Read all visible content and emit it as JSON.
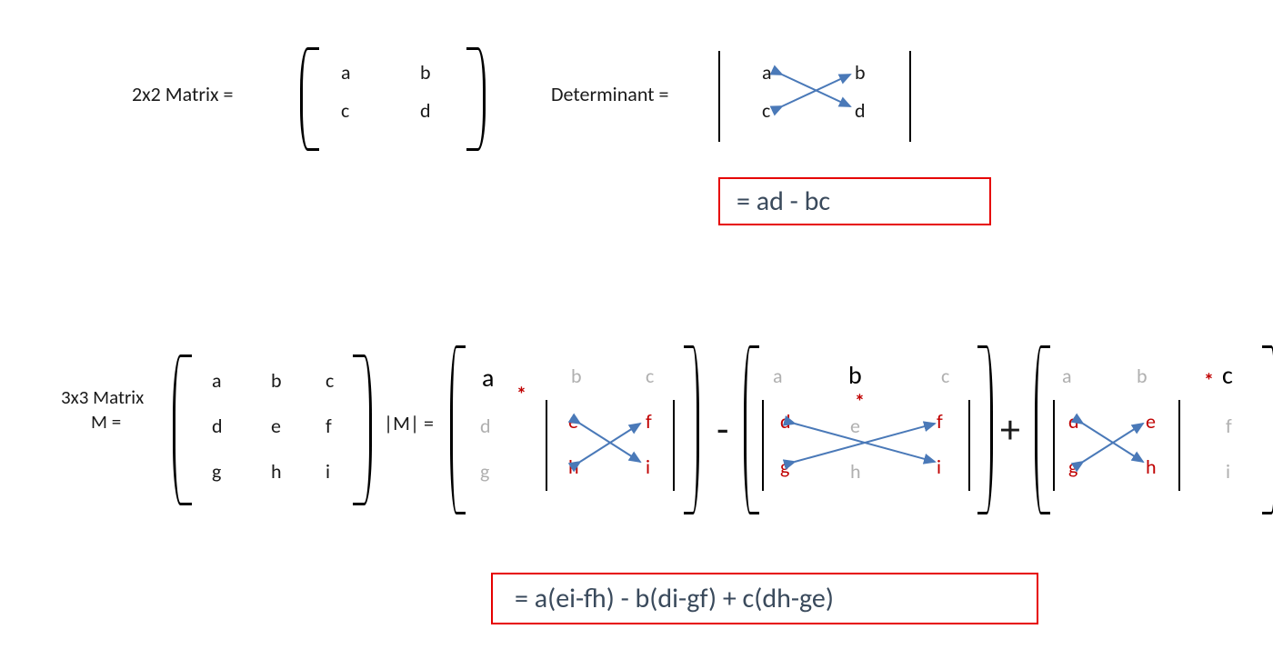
{
  "top": {
    "label2x2": "2x2 Matrix  =",
    "labelDet": "Determinant =",
    "m": {
      "a": "a",
      "b": "b",
      "c": "c",
      "d": "d"
    },
    "result": "= ad - bc"
  },
  "bottom": {
    "label3x3a": "3x3 Matrix",
    "label3x3b": "M =",
    "labelMdet": "|M| =",
    "m": {
      "a": "a",
      "b": "b",
      "c": "c",
      "d": "d",
      "e": "e",
      "f": "f",
      "g": "g",
      "h": "h",
      "i": "i"
    },
    "minus": "-",
    "plus": "+",
    "star": "*",
    "result": "=     a(ei-fh) - b(di-gf) + c(dh-ge)"
  }
}
